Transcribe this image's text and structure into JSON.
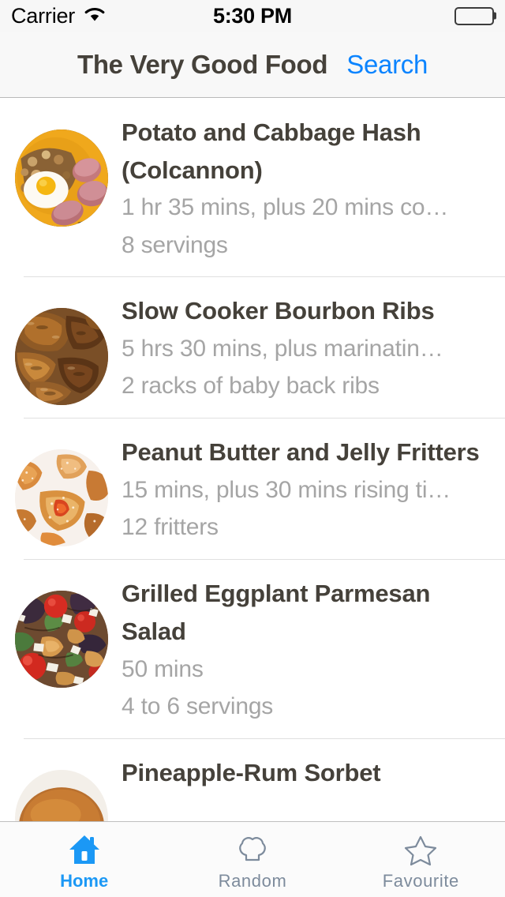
{
  "status_bar": {
    "carrier": "Carrier",
    "wifi_icon": "wifi-icon",
    "time": "5:30 PM",
    "battery_icon": "battery-full-icon"
  },
  "nav_bar": {
    "title": "The Very Good Food",
    "search_label": "Search",
    "accent_color": "#0b84ff",
    "title_color": "#45413a"
  },
  "recipes": [
    {
      "title": "Potato and Cabbage Hash (Colcannon)",
      "time": "1 hr 35 mins, plus 20 mins co…",
      "yield": "8 servings",
      "thumb": "colcannon-hash-thumbnail"
    },
    {
      "title": "Slow Cooker Bourbon Ribs",
      "time": "5 hrs 30 mins, plus marinatin…",
      "yield": "2 racks of baby back ribs",
      "thumb": "bourbon-ribs-thumbnail"
    },
    {
      "title": "Peanut Butter and Jelly Fritters",
      "time": "15 mins, plus 30 mins rising ti…",
      "yield": "12 fritters",
      "thumb": "pbj-fritters-thumbnail"
    },
    {
      "title": "Grilled Eggplant Parmesan Salad",
      "time": "50 mins",
      "yield": "4 to 6 servings",
      "thumb": "eggplant-salad-thumbnail"
    },
    {
      "title": "Pineapple-Rum Sorbet",
      "time": "",
      "yield": "",
      "thumb": "pineapple-rum-sorbet-thumbnail"
    }
  ],
  "tab_bar": {
    "active_color": "#1b98f5",
    "inactive_color": "#7d8b9c",
    "tabs": [
      {
        "label": "Home",
        "icon": "home-icon",
        "active": true
      },
      {
        "label": "Random",
        "icon": "chef-hat-icon",
        "active": false
      },
      {
        "label": "Favourite",
        "icon": "star-icon",
        "active": false
      }
    ]
  }
}
